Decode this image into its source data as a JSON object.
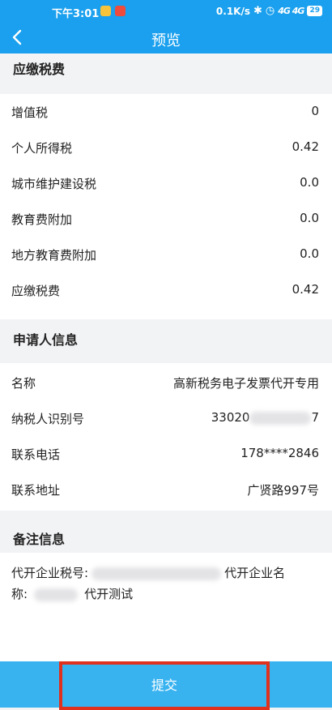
{
  "statusbar": {
    "time": "下午3:01",
    "speed": "0.1K/s",
    "signal": "4G 4G",
    "battery": "29"
  },
  "header": {
    "title": "预览"
  },
  "tax_section": {
    "title": "应缴税费",
    "rows": [
      {
        "label": "增值税",
        "value": "0"
      },
      {
        "label": "个人所得税",
        "value": "0.42"
      },
      {
        "label": "城市维护建设税",
        "value": "0.0"
      },
      {
        "label": "教育费附加",
        "value": "0.0"
      },
      {
        "label": "地方教育费附加",
        "value": "0.0"
      },
      {
        "label": "应缴税费",
        "value": "0.42"
      }
    ]
  },
  "applicant_section": {
    "title": "申请人信息",
    "rows": [
      {
        "label": "名称",
        "value": "高新税务电子发票代开专用"
      },
      {
        "label": "纳税人识别号",
        "value_start": "33020",
        "value_end": "7"
      },
      {
        "label": "联系电话",
        "value": "178****2846"
      },
      {
        "label": "联系地址",
        "value": "广贤路997号"
      }
    ]
  },
  "remarks_section": {
    "title": "备注信息",
    "line1_prefix": "代开企业税号:",
    "line1_suffix": "代开企业名",
    "line2_prefix": "称:",
    "line2_suffix": "代开测试"
  },
  "footer": {
    "submit_label": "提交"
  },
  "colors": {
    "primary": "#1aa0ee",
    "submit_bg": "#38b3f0",
    "highlight_border": "#e0301e"
  }
}
